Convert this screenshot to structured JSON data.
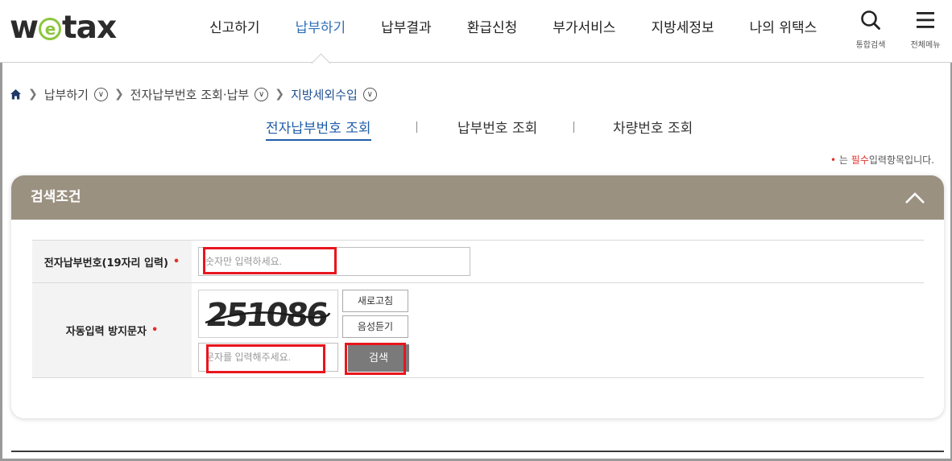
{
  "header": {
    "logo": {
      "pre": "w",
      "mid": "e",
      "post": "tax"
    },
    "nav": [
      "신고하기",
      "납부하기",
      "납부결과",
      "환급신청",
      "부가서비스",
      "지방세정보",
      "나의 위택스"
    ],
    "active_nav": "납부하기",
    "search_label": "통합검색",
    "menu_label": "전체메뉴"
  },
  "breadcrumb": {
    "items": [
      "납부하기",
      "전자납부번호 조회·납부",
      "지방세외수입"
    ]
  },
  "tabs": [
    "전자납부번호 조회",
    "납부번호 조회",
    "차량번호 조회"
  ],
  "required_note": {
    "dot": "•",
    "prefix": "는",
    "must": "필수",
    "suffix": "입력항목입니다."
  },
  "panel": {
    "title": "검색조건",
    "fields": {
      "number_label": "전자납부번호(19자리 입력)",
      "number_placeholder": "숫자만 입력하세요.",
      "captcha_label": "자동입력 방지문자",
      "captcha_text": "251086",
      "refresh_label": "새로고침",
      "audio_label": "음성듣기",
      "captcha_placeholder": "문자를 입력해주세요.",
      "search_button": "검색"
    },
    "required_mark": "•"
  },
  "colors": {
    "accent": "#2f6fb6",
    "panel_header": "#9b9181",
    "highlight": "#e8161d",
    "required": "#e0312a"
  }
}
